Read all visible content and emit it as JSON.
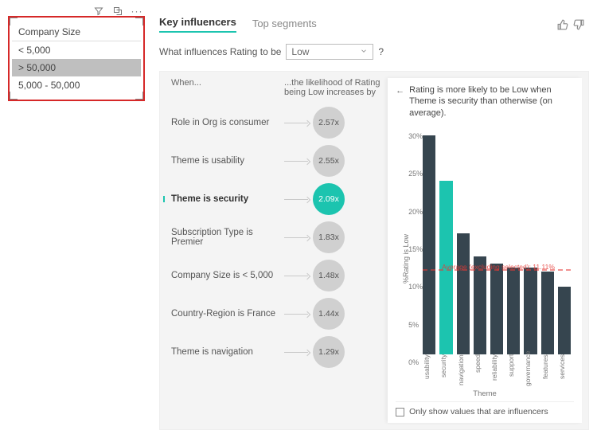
{
  "slicer": {
    "title": "Company Size",
    "items": [
      {
        "label": "< 5,000",
        "selected": false
      },
      {
        "label": "> 50,000",
        "selected": true
      },
      {
        "label": "5,000 - 50,000",
        "selected": false
      }
    ]
  },
  "toolbar": {
    "filter_icon": "filter-icon",
    "focus_icon": "focus-mode-icon",
    "more_icon": "more-options-icon"
  },
  "viz": {
    "tabs": [
      {
        "label": "Key influencers",
        "active": true
      },
      {
        "label": "Top segments",
        "active": false
      }
    ],
    "feedback": {
      "up": "thumbs-up-icon",
      "down": "thumbs-down-icon"
    },
    "question_prefix": "What influences Rating to be",
    "dropdown_value": "Low",
    "question_suffix": "?",
    "headers": {
      "when": "When...",
      "effect": "...the likelihood of Rating being Low increases by"
    },
    "influencers": [
      {
        "label": "Role in Org is consumer",
        "value": "2.57x",
        "selected": false
      },
      {
        "label": "Theme is usability",
        "value": "2.55x",
        "selected": false
      },
      {
        "label": "Theme is security",
        "value": "2.09x",
        "selected": true
      },
      {
        "label": "Subscription Type is Premier",
        "value": "1.83x",
        "selected": false
      },
      {
        "label": "Company Size is < 5,000",
        "value": "1.48x",
        "selected": false
      },
      {
        "label": "Country-Region is France",
        "value": "1.44x",
        "selected": false
      },
      {
        "label": "Theme is navigation",
        "value": "1.29x",
        "selected": false
      }
    ],
    "insight": {
      "text": "Rating is more likely to be Low when Theme is security than otherwise (on average).",
      "average_label": "Average (excluding selected): 11.11%",
      "only_show_label": "Only show values that are influencers",
      "only_show_checked": false
    }
  },
  "chart_data": {
    "type": "bar",
    "title": "",
    "xlabel": "Theme",
    "ylabel": "%Rating is Low",
    "ylim": [
      0,
      30
    ],
    "yticks": [
      0,
      5,
      10,
      15,
      20,
      25,
      30
    ],
    "categories": [
      "usability",
      "security",
      "navigation",
      "speed",
      "reliability",
      "support",
      "governance",
      "features",
      "services"
    ],
    "values": [
      29,
      23,
      16,
      13,
      12,
      11.5,
      11.5,
      11,
      9
    ],
    "highlight_index": 1,
    "average_value": 11.11
  }
}
